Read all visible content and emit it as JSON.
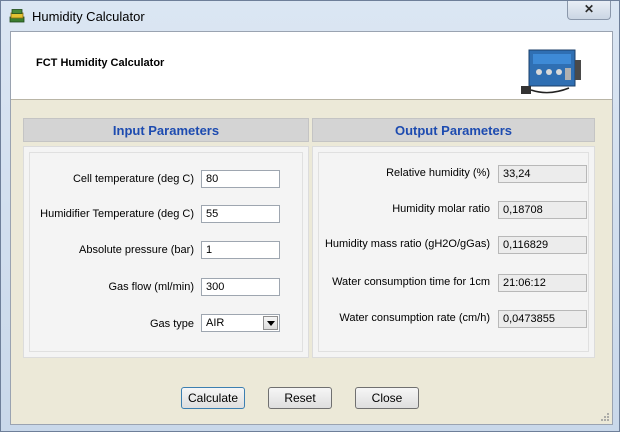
{
  "window": {
    "title": "Humidity Calculator",
    "close_glyph": "✕"
  },
  "header": {
    "title": "FCT Humidity Calculator"
  },
  "input_panel": {
    "title": "Input Parameters",
    "fields": [
      {
        "label": "Cell temperature (deg C)",
        "value": "80"
      },
      {
        "label": "Humidifier Temperature (deg C)",
        "value": "55"
      },
      {
        "label": "Absolute pressure (bar)",
        "value": "1"
      },
      {
        "label": "Gas flow (ml/min)",
        "value": "300"
      }
    ],
    "gas_type": {
      "label": "Gas type",
      "value": "AIR"
    }
  },
  "output_panel": {
    "title": "Output Parameters",
    "fields": [
      {
        "label": "Relative humidity (%)",
        "value": "33,24"
      },
      {
        "label": "Humidity molar ratio",
        "value": "0,18708"
      },
      {
        "label": "Humidity mass ratio (gH2O/gGas)",
        "value": "0,116829"
      },
      {
        "label": "Water consumption time for 1cm",
        "value": "21:06:12"
      },
      {
        "label": "Water consumption rate (cm/h)",
        "value": "0,0473855"
      }
    ]
  },
  "buttons": {
    "calculate": "Calculate",
    "reset": "Reset",
    "close": "Close"
  },
  "icons": {
    "app": "app-icon",
    "device": "device-image"
  }
}
